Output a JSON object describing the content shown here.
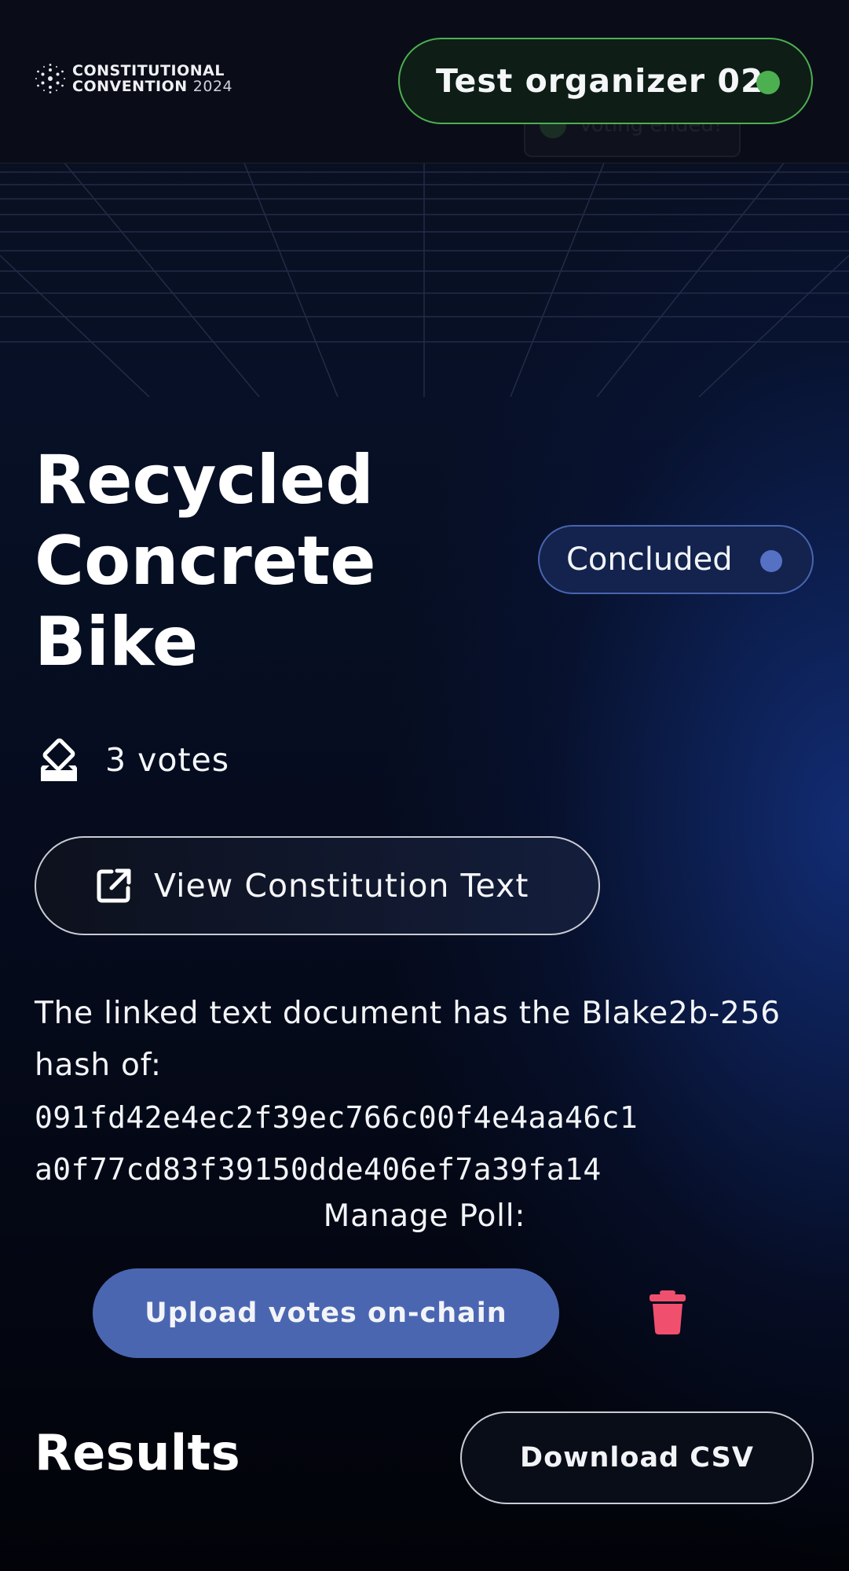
{
  "header": {
    "logo": {
      "line1": "CONSTITUTIONAL",
      "line2": "CONVENTION",
      "year": "2024",
      "icon": "cardano-logo-icon"
    },
    "organizer": {
      "label": "Test organizer 02",
      "status_color": "#4caf50"
    },
    "toast": {
      "label": "Voting ended!",
      "icon": "check-circle-icon"
    }
  },
  "poll": {
    "title": "Recycled Concrete Bike",
    "status": {
      "label": "Concluded",
      "color": "#5571c4"
    },
    "votes": {
      "label": "3 votes",
      "icon": "ballot-box-icon"
    },
    "view_button": {
      "label": "View Constitution Text",
      "icon": "external-link-icon"
    },
    "hash": {
      "intro": "The linked text document has the Blake2b-256 hash of:",
      "value": "091fd42e4ec2f39ec766c00f4e4aa46c1a0f77cd83f39150dde406ef7a39fa14"
    },
    "manage": {
      "label": "Manage Poll:",
      "upload_button": "Upload votes on-chain",
      "delete_icon": "trash-icon"
    }
  },
  "results": {
    "title": "Results",
    "download_button": "Download CSV"
  },
  "colors": {
    "accent": "#4b66b1",
    "success": "#4caf50",
    "danger": "#f0506e"
  }
}
